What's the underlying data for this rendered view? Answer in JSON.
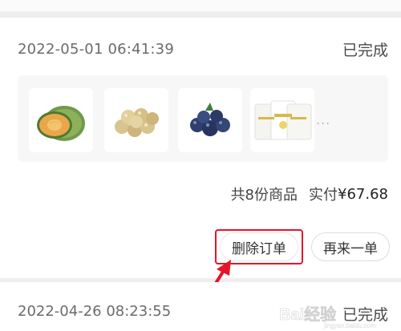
{
  "order1": {
    "time": "2022-05-01 06:41:39",
    "status": "已完成",
    "products": [
      {
        "icon": "melon-icon"
      },
      {
        "icon": "longan-icon"
      },
      {
        "icon": "blueberry-icon"
      },
      {
        "icon": "yogurt-cups-icon"
      }
    ],
    "more": "...",
    "count_text": "共8份商品",
    "paid_label": "实付",
    "paid_amount": "¥67.68",
    "delete_label": "删除订单",
    "reorder_label": "再来一单"
  },
  "order2": {
    "time": "2022-04-26 08:23:55",
    "status": "已完成"
  },
  "colors": {
    "highlight_box": "#e4152a",
    "arrow": "#e4152a"
  },
  "watermark": {
    "text": "Bai经验",
    "sub": "jingyan.baidu.com"
  }
}
